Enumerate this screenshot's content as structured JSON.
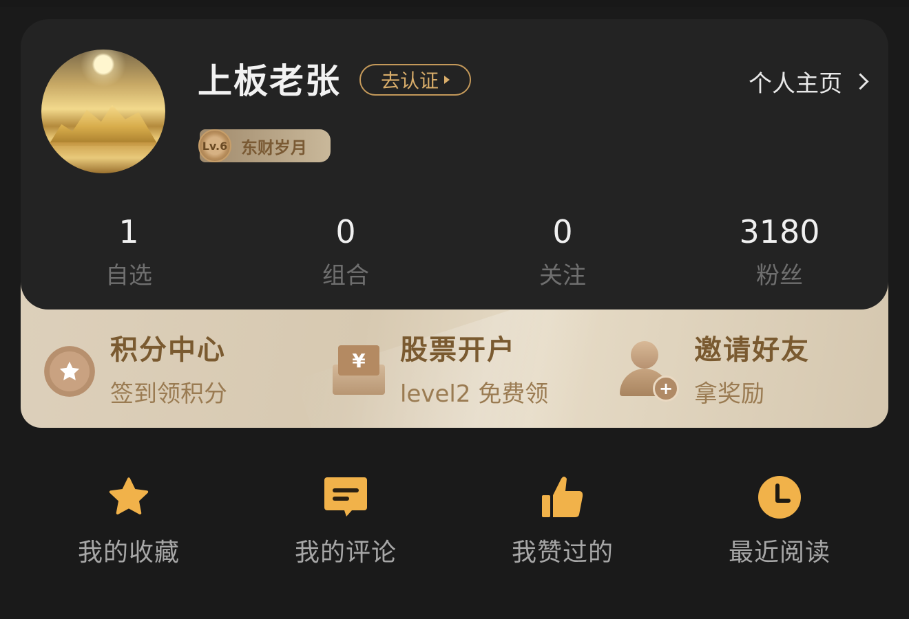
{
  "profile": {
    "username": "上板老张",
    "verify_label": "去认证",
    "level_badge": "Lv.6",
    "level_title": "东财岁月",
    "profile_link_label": "个人主页"
  },
  "stats": [
    {
      "value": "1",
      "label": "自选"
    },
    {
      "value": "0",
      "label": "组合"
    },
    {
      "value": "0",
      "label": "关注"
    },
    {
      "value": "3180",
      "label": "粉丝"
    }
  ],
  "features": [
    {
      "title": "积分中心",
      "subtitle": "签到领积分",
      "icon": "star-medal-icon"
    },
    {
      "title": "股票开户",
      "subtitle": "level2 免费领",
      "icon": "yen-envelope-icon",
      "symbol": "¥"
    },
    {
      "title": "邀请好友",
      "subtitle": "拿奖励",
      "icon": "add-user-icon",
      "symbol": "+"
    }
  ],
  "quick_actions": [
    {
      "label": "我的收藏",
      "icon": "star-icon"
    },
    {
      "label": "我的评论",
      "icon": "comment-icon"
    },
    {
      "label": "我赞过的",
      "icon": "thumbs-up-icon"
    },
    {
      "label": "最近阅读",
      "icon": "clock-icon"
    }
  ],
  "colors": {
    "accent_gold": "#f1b24a",
    "verify_border": "#c4995a",
    "feature_title": "#7a5a30"
  }
}
